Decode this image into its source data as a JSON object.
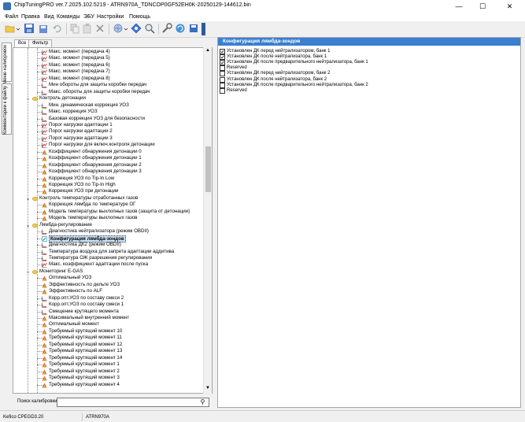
{
  "window": {
    "title": "ChipTuningPRO ver.7.2025.102.5219 - ATRN970A_TDNCOP0GF52EH0K-20250129-144612.bin",
    "minimize_glyph": "—",
    "maximize_glyph": "☐",
    "close_glyph": "✕"
  },
  "menu": [
    "Файл",
    "Правка",
    "Вид",
    "Команды",
    "ЭБУ",
    "Настройки",
    "Помощь"
  ],
  "toolbar": {
    "icons": [
      "open-folder-icon",
      "save-icon",
      "save-as-icon",
      "undo-icon",
      "copy-icon",
      "paste-icon",
      "delete-icon",
      "network-icon",
      "diamond-icon",
      "search-icon",
      "tools-icon",
      "refresh-icon",
      "save-small-icon"
    ]
  },
  "side_tabs": [
    "Меню калибровок",
    "Комментарии к файлу"
  ],
  "left_tabs": [
    "Все",
    "Фильтр"
  ],
  "tree": [
    {
      "label": "Макс. момент (передача 4)",
      "indent": 2,
      "type": "curve"
    },
    {
      "label": "Макс. момент (передача 5)",
      "indent": 2,
      "type": "curve"
    },
    {
      "label": "Макс. момент (передача 6)",
      "indent": 2,
      "type": "curve"
    },
    {
      "label": "Макс. момент (передача 7)",
      "indent": 2,
      "type": "curve"
    },
    {
      "label": "Макс. момент (передача 8)",
      "indent": 2,
      "type": "curve"
    },
    {
      "label": "Мин обороты для защиты коробки передач",
      "indent": 2,
      "type": "value"
    },
    {
      "label": "Макс. обороты для защиты коробки передач",
      "indent": 2,
      "type": "value"
    },
    {
      "label": "Контроль детонации",
      "indent": 1,
      "type": "group"
    },
    {
      "label": "Мин. динамическая коррекция УОЗ",
      "indent": 2,
      "type": "value"
    },
    {
      "label": "Макс. коррекция УОЗ",
      "indent": 2,
      "type": "value"
    },
    {
      "label": "Базовая коррекция УОЗ для безопасности",
      "indent": 2,
      "type": "value"
    },
    {
      "label": "Порог нагрузки адаптации 1",
      "indent": 2,
      "type": "curve"
    },
    {
      "label": "Порог нагрузки адаптации 2",
      "indent": 2,
      "type": "curve"
    },
    {
      "label": "Порог нагрузки адаптации 3",
      "indent": 2,
      "type": "curve"
    },
    {
      "label": "Порог нагрузки для включ.контроля детонации",
      "indent": 2,
      "type": "curve"
    },
    {
      "label": "Коэффициент обнаружения детонации 0",
      "indent": 2,
      "type": "map"
    },
    {
      "label": "Коэффициент обнаружения детонации 1",
      "indent": 2,
      "type": "map"
    },
    {
      "label": "Коэффициент обнаружения детонации 2",
      "indent": 2,
      "type": "map"
    },
    {
      "label": "Коэффициент обнаружения детонации 3",
      "indent": 2,
      "type": "map"
    },
    {
      "label": "Коррекция УОЗ по Tip-In Low",
      "indent": 2,
      "type": "map"
    },
    {
      "label": "Коррекция УОЗ по Tip-In High",
      "indent": 2,
      "type": "map"
    },
    {
      "label": "Коррекция УОЗ при детонации",
      "indent": 2,
      "type": "map"
    },
    {
      "label": "Контроль температуры отработанных газов",
      "indent": 1,
      "type": "group"
    },
    {
      "label": "Коррекция лямбда по температуре ОГ",
      "indent": 2,
      "type": "map"
    },
    {
      "label": "Модель температуры выхлопных газов (защита от детонации)",
      "indent": 2,
      "type": "map"
    },
    {
      "label": "Модель температуры выхлопных газов",
      "indent": 2,
      "type": "map"
    },
    {
      "label": "Лямбда-регулирование",
      "indent": 1,
      "type": "group"
    },
    {
      "label": "Диагностика нейтрализатора (режим OBDII)",
      "indent": 2,
      "type": "value"
    },
    {
      "label": "Конфигурация лямбда-зондов",
      "indent": 2,
      "type": "edit",
      "selected": true
    },
    {
      "label": "Диагностика ДК2 (режим OBDII)",
      "indent": 2,
      "type": "value"
    },
    {
      "label": "Температура воздуха для запрета адаптации аддитива",
      "indent": 2,
      "type": "value"
    },
    {
      "label": "Температура ОЖ разрешения регулирования",
      "indent": 2,
      "type": "value"
    },
    {
      "label": "Макс. коэффициент адаптации после пуска",
      "indent": 2,
      "type": "curve"
    },
    {
      "label": "Мониторинг E-GAS",
      "indent": 1,
      "type": "group"
    },
    {
      "label": "Оптимальный УОЗ",
      "indent": 2,
      "type": "map"
    },
    {
      "label": "Эффективность по дельте УОЗ",
      "indent": 2,
      "type": "map"
    },
    {
      "label": "Эффективность по ALF",
      "indent": 2,
      "type": "map"
    },
    {
      "label": "Корр.опт.УОЗ по составу смеси 2",
      "indent": 2,
      "type": "value"
    },
    {
      "label": "Корр.опт.УОЗ по составу смеси 1",
      "indent": 2,
      "type": "value"
    },
    {
      "label": "Смещение крутящего момента",
      "indent": 2,
      "type": "value"
    },
    {
      "label": "Максимальный внутренний момент",
      "indent": 2,
      "type": "map"
    },
    {
      "label": "Оптимальный момент",
      "indent": 2,
      "type": "map"
    },
    {
      "label": "Требуемый крутящий момент 10",
      "indent": 2,
      "type": "map"
    },
    {
      "label": "Требуемый крутящий момент 11",
      "indent": 2,
      "type": "map"
    },
    {
      "label": "Требуемый крутящий момент 12",
      "indent": 2,
      "type": "map"
    },
    {
      "label": "Требуемый крутящий момент 13",
      "indent": 2,
      "type": "map"
    },
    {
      "label": "Требуемый крутящий момент 14",
      "indent": 2,
      "type": "map"
    },
    {
      "label": "Требуемый крутящий момент 1",
      "indent": 2,
      "type": "map"
    },
    {
      "label": "Требуемый крутящий момент 2",
      "indent": 2,
      "type": "map"
    },
    {
      "label": "Требуемый крутящий момент 3",
      "indent": 2,
      "type": "map"
    },
    {
      "label": "Требуемый крутящий момент 4",
      "indent": 2,
      "type": "map"
    }
  ],
  "search": {
    "label": "Поиск калибровки",
    "value": "",
    "icon": "search-icon",
    "glyph": "⚲"
  },
  "right_panel": {
    "header": "Конфигурация лямбда-зондов",
    "options": [
      {
        "label": "Установлен ДК перед нейтрализатором, банк 1",
        "checked": true
      },
      {
        "label": "Установлен ДК после нейтрализатора, банк 1",
        "checked": true
      },
      {
        "label": "Установлен ДК после предварительного нейтрализатора, банк 1",
        "checked": true
      },
      {
        "label": "Reserved",
        "checked": false
      },
      {
        "label": "Установлен ДК перед нейтрализатором, банк 2",
        "checked": false
      },
      {
        "label": "Установлен ДК после нейтрализатора, банк 2",
        "checked": false
      },
      {
        "label": "Установлен ДК после предварительного нейтрализатора, банк 2",
        "checked": false
      },
      {
        "label": "Reserved",
        "checked": false
      }
    ]
  },
  "status": [
    "Kefico CPEGD3.20",
    "ATRN970A"
  ],
  "colors": {
    "header_blue": "#3a7fd0",
    "selection": "#cce4f7",
    "folder": "#f2c94c"
  }
}
